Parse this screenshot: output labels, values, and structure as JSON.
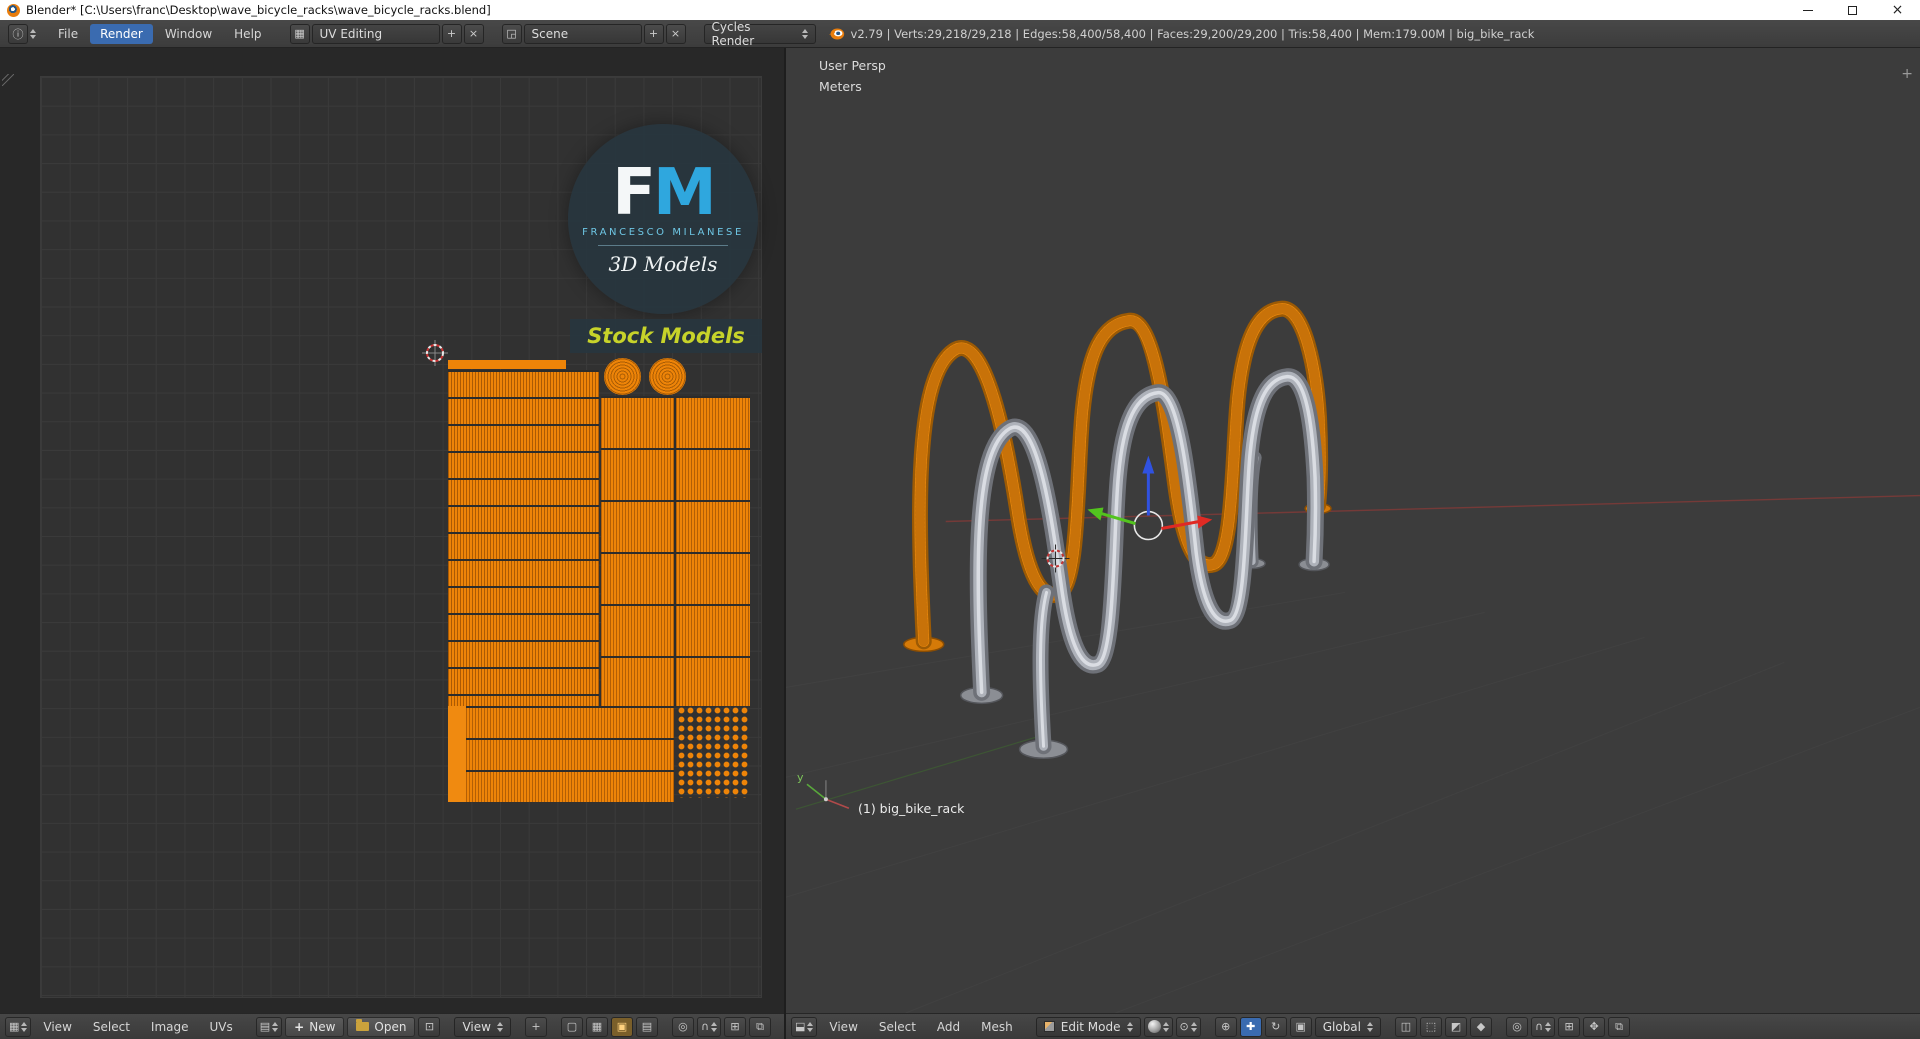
{
  "window": {
    "title": "Blender* [C:\\Users\\franc\\Desktop\\wave_bicycle_racks\\wave_bicycle_racks.blend]"
  },
  "topbar": {
    "menus": [
      "File",
      "Render",
      "Window",
      "Help"
    ],
    "layout_value": "UV Editing",
    "scene_value": "Scene",
    "engine_value": "Cycles Render",
    "stats": "v2.79 | Verts:29,218/29,218 | Edges:58,400/58,400 | Faces:29,200/29,200 | Tris:58,400 | Mem:179.00M | big_bike_rack"
  },
  "uv_editor": {
    "watermark": {
      "f": "F",
      "m": "M",
      "name": "FRANCESCO MILANESE",
      "models": "3D Models",
      "banner": "Stock Models"
    },
    "footer": {
      "menus": [
        "View",
        "Select",
        "Image",
        "UVs"
      ],
      "new_label": "New",
      "open_label": "Open",
      "view_label": "View"
    }
  },
  "viewport": {
    "persp_label": "User Persp",
    "units_label": "Meters",
    "object_label": "(1) big_bike_rack",
    "axis_y_label": "y",
    "footer": {
      "menus": [
        "View",
        "Select",
        "Add",
        "Mesh"
      ],
      "mode_value": "Edit Mode",
      "orientation_value": "Global"
    }
  },
  "colors": {
    "uv_orange": "#ee8408",
    "menu_active_blue": "#3a6bb0",
    "rack_orange": "#ef8b0e",
    "rack_gray": "#9fa3ab"
  }
}
